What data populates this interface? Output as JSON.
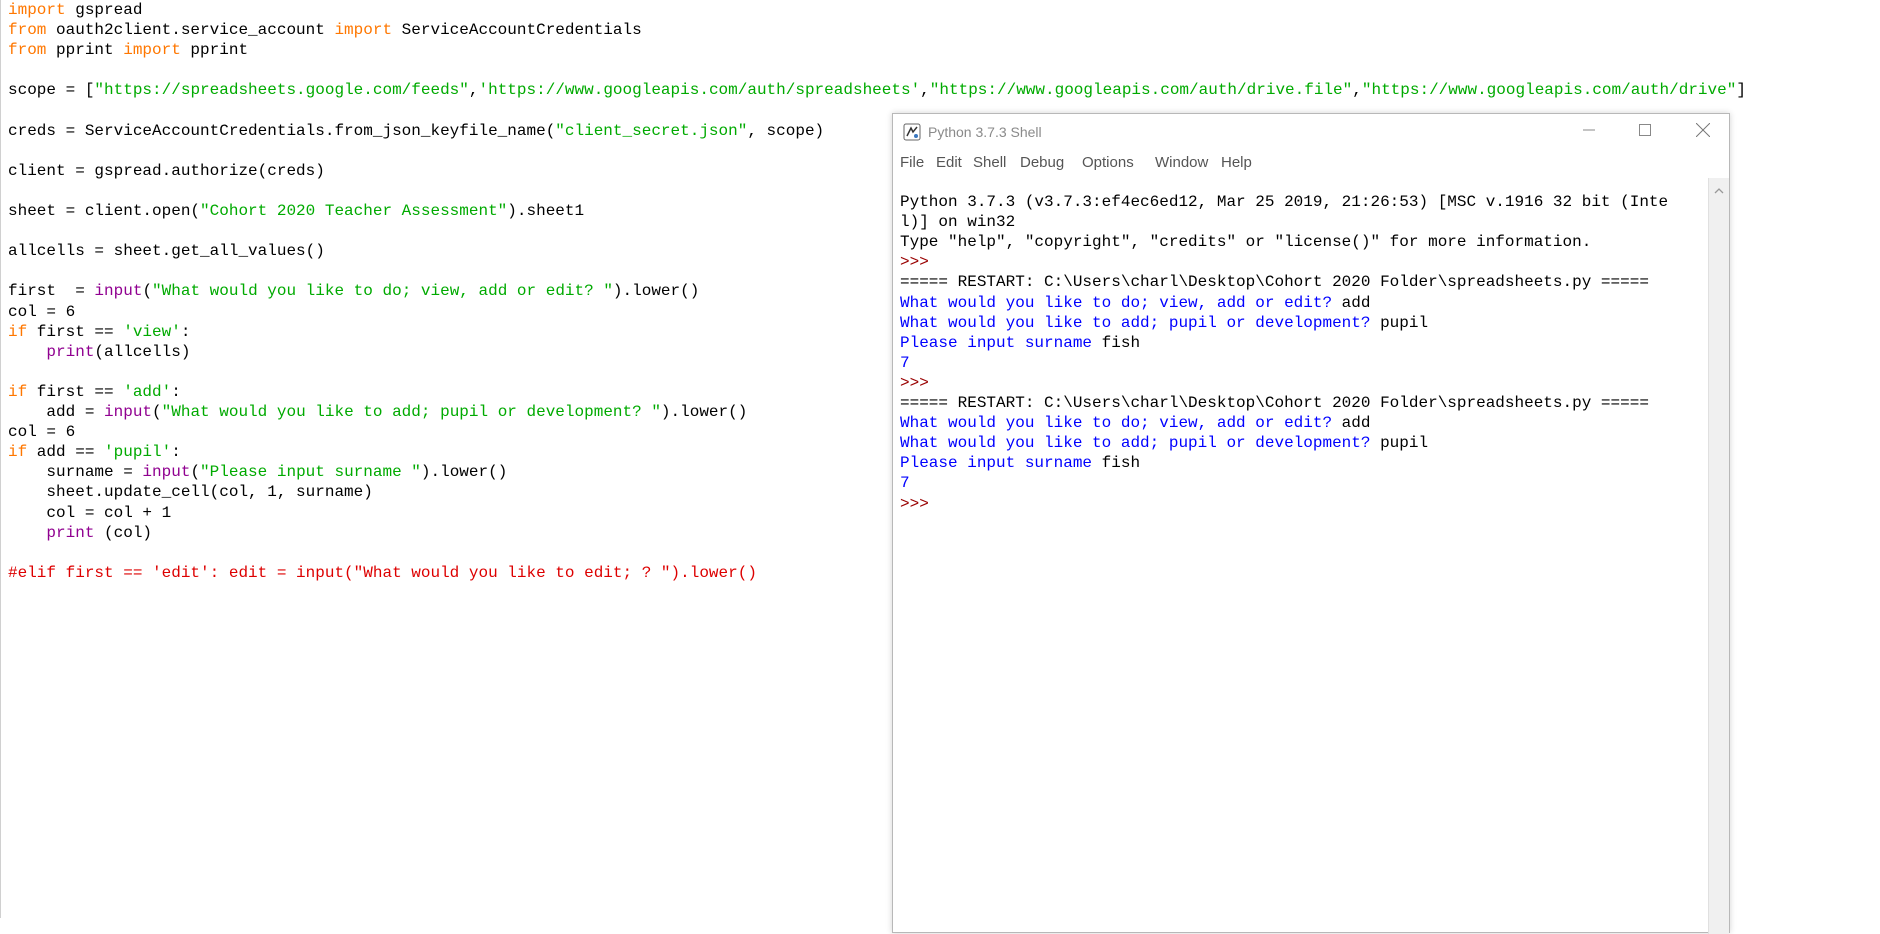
{
  "editor": {
    "lines": [
      {
        "parts": [
          {
            "t": "import",
            "c": "kw"
          },
          {
            "t": " gspread",
            "c": "def"
          }
        ]
      },
      {
        "parts": [
          {
            "t": "from",
            "c": "kw"
          },
          {
            "t": " oauth2client.service_account ",
            "c": "def"
          },
          {
            "t": "import",
            "c": "kw"
          },
          {
            "t": " ServiceAccountCredentials",
            "c": "def"
          }
        ]
      },
      {
        "parts": [
          {
            "t": "from",
            "c": "kw"
          },
          {
            "t": " pprint ",
            "c": "def"
          },
          {
            "t": "import",
            "c": "kw"
          },
          {
            "t": " pprint",
            "c": "def"
          }
        ]
      },
      {
        "parts": []
      },
      {
        "parts": [
          {
            "t": "scope = [",
            "c": "def"
          },
          {
            "t": "\"https://spreadsheets.google.com/feeds\"",
            "c": "str"
          },
          {
            "t": ",",
            "c": "def"
          },
          {
            "t": "'https://www.googleapis.com/auth/spreadsheets'",
            "c": "str"
          },
          {
            "t": ",",
            "c": "def"
          },
          {
            "t": "\"https://www.googleapis.com/auth/drive.file\"",
            "c": "str"
          },
          {
            "t": ",",
            "c": "def"
          },
          {
            "t": "\"https://www.googleapis.com/auth/drive\"",
            "c": "str"
          },
          {
            "t": "]",
            "c": "def"
          }
        ]
      },
      {
        "parts": []
      },
      {
        "parts": [
          {
            "t": "creds = ServiceAccountCredentials.from_json_keyfile_name(",
            "c": "def"
          },
          {
            "t": "\"client_secret.json\"",
            "c": "str"
          },
          {
            "t": ", scope)",
            "c": "def"
          }
        ]
      },
      {
        "parts": []
      },
      {
        "parts": [
          {
            "t": "client = gspread.authorize(creds)",
            "c": "def"
          }
        ]
      },
      {
        "parts": []
      },
      {
        "parts": [
          {
            "t": "sheet = client.open(",
            "c": "def"
          },
          {
            "t": "\"Cohort 2020 Teacher Assessment\"",
            "c": "str"
          },
          {
            "t": ").sheet1",
            "c": "def"
          }
        ]
      },
      {
        "parts": []
      },
      {
        "parts": [
          {
            "t": "allcells = sheet.get_all_values()",
            "c": "def"
          }
        ]
      },
      {
        "parts": []
      },
      {
        "parts": [
          {
            "t": "first  = ",
            "c": "def"
          },
          {
            "t": "input",
            "c": "bi"
          },
          {
            "t": "(",
            "c": "def"
          },
          {
            "t": "\"What would you like to do; view, add or edit? \"",
            "c": "str"
          },
          {
            "t": ").lower()",
            "c": "def"
          }
        ]
      },
      {
        "parts": [
          {
            "t": "col = 6",
            "c": "def"
          }
        ]
      },
      {
        "parts": [
          {
            "t": "if",
            "c": "kw"
          },
          {
            "t": " first == ",
            "c": "def"
          },
          {
            "t": "'view'",
            "c": "str"
          },
          {
            "t": ":",
            "c": "def"
          }
        ]
      },
      {
        "parts": [
          {
            "t": "    ",
            "c": "def"
          },
          {
            "t": "print",
            "c": "bi"
          },
          {
            "t": "(allcells)",
            "c": "def"
          }
        ]
      },
      {
        "parts": []
      },
      {
        "parts": [
          {
            "t": "if",
            "c": "kw"
          },
          {
            "t": " first == ",
            "c": "def"
          },
          {
            "t": "'add'",
            "c": "str"
          },
          {
            "t": ":",
            "c": "def"
          }
        ]
      },
      {
        "parts": [
          {
            "t": "    add = ",
            "c": "def"
          },
          {
            "t": "input",
            "c": "bi"
          },
          {
            "t": "(",
            "c": "def"
          },
          {
            "t": "\"What would you like to add; pupil or development? \"",
            "c": "str"
          },
          {
            "t": ").lower()",
            "c": "def"
          }
        ]
      },
      {
        "parts": [
          {
            "t": "col = 6",
            "c": "def"
          }
        ]
      },
      {
        "parts": [
          {
            "t": "if",
            "c": "kw"
          },
          {
            "t": " add == ",
            "c": "def"
          },
          {
            "t": "'pupil'",
            "c": "str"
          },
          {
            "t": ":",
            "c": "def"
          }
        ]
      },
      {
        "parts": [
          {
            "t": "    surname = ",
            "c": "def"
          },
          {
            "t": "input",
            "c": "bi"
          },
          {
            "t": "(",
            "c": "def"
          },
          {
            "t": "\"Please input surname \"",
            "c": "str"
          },
          {
            "t": ").lower()",
            "c": "def"
          }
        ]
      },
      {
        "parts": [
          {
            "t": "    sheet.update_cell(col, 1, surname)",
            "c": "def"
          }
        ]
      },
      {
        "parts": [
          {
            "t": "    col = col + 1",
            "c": "def"
          }
        ]
      },
      {
        "parts": [
          {
            "t": "    ",
            "c": "def"
          },
          {
            "t": "print",
            "c": "bi"
          },
          {
            "t": " (col)",
            "c": "def"
          }
        ]
      },
      {
        "parts": []
      },
      {
        "parts": [
          {
            "t": "#elif first == 'edit': edit = input(\"What would you like to edit; ? \").lower()",
            "c": "cmt"
          }
        ]
      }
    ]
  },
  "shell": {
    "title": "Python 3.7.3 Shell",
    "menu": [
      "File",
      "Edit",
      "Shell",
      "Debug",
      "Options",
      "Window",
      "Help"
    ],
    "output": [
      {
        "parts": [
          {
            "t": "Python 3.7.3 (v3.7.3:ef4ec6ed12, Mar 25 2019, 21:26:53) [MSC v.1916 32 bit (Inte",
            "c": "def"
          }
        ]
      },
      {
        "parts": [
          {
            "t": "l)] on win32",
            "c": "def"
          }
        ]
      },
      {
        "parts": [
          {
            "t": "Type \"help\", \"copyright\", \"credits\" or \"license()\" for more information.",
            "c": "def"
          }
        ]
      },
      {
        "parts": [
          {
            "t": ">>> ",
            "c": "prompt"
          }
        ]
      },
      {
        "parts": [
          {
            "t": "===== RESTART: C:\\Users\\charl\\Desktop\\Cohort 2020 Folder\\spreadsheets.py =====",
            "c": "def"
          }
        ]
      },
      {
        "parts": [
          {
            "t": "What would you like to do; view, add or edit? ",
            "c": "stdout"
          },
          {
            "t": "add",
            "c": "def"
          }
        ]
      },
      {
        "parts": [
          {
            "t": "What would you like to add; pupil or development? ",
            "c": "stdout"
          },
          {
            "t": "pupil",
            "c": "def"
          }
        ]
      },
      {
        "parts": [
          {
            "t": "Please input surname ",
            "c": "stdout"
          },
          {
            "t": "fish",
            "c": "def"
          }
        ]
      },
      {
        "parts": [
          {
            "t": "7",
            "c": "ret"
          }
        ]
      },
      {
        "parts": [
          {
            "t": ">>> ",
            "c": "prompt"
          }
        ]
      },
      {
        "parts": [
          {
            "t": "===== RESTART: C:\\Users\\charl\\Desktop\\Cohort 2020 Folder\\spreadsheets.py =====",
            "c": "def"
          }
        ]
      },
      {
        "parts": [
          {
            "t": "What would you like to do; view, add or edit? ",
            "c": "stdout"
          },
          {
            "t": "add",
            "c": "def"
          }
        ]
      },
      {
        "parts": [
          {
            "t": "What would you like to add; pupil or development? ",
            "c": "stdout"
          },
          {
            "t": "pupil",
            "c": "def"
          }
        ]
      },
      {
        "parts": [
          {
            "t": "Please input surname ",
            "c": "stdout"
          },
          {
            "t": "fish",
            "c": "def"
          }
        ]
      },
      {
        "parts": [
          {
            "t": "7",
            "c": "ret"
          }
        ]
      },
      {
        "parts": [
          {
            "t": ">>> ",
            "c": "prompt"
          }
        ]
      }
    ]
  },
  "icons": {
    "app": "python-idle-icon",
    "minimize": "minimize-icon",
    "maximize": "maximize-icon",
    "close": "close-icon",
    "scroll_up": "scroll-up-arrow-icon"
  },
  "colors": {
    "keyword": "#ff7700",
    "string": "#00aa00",
    "builtin": "#900090",
    "comment": "#dd0000",
    "stdout": "#0000ff",
    "prompt": "#990000"
  }
}
